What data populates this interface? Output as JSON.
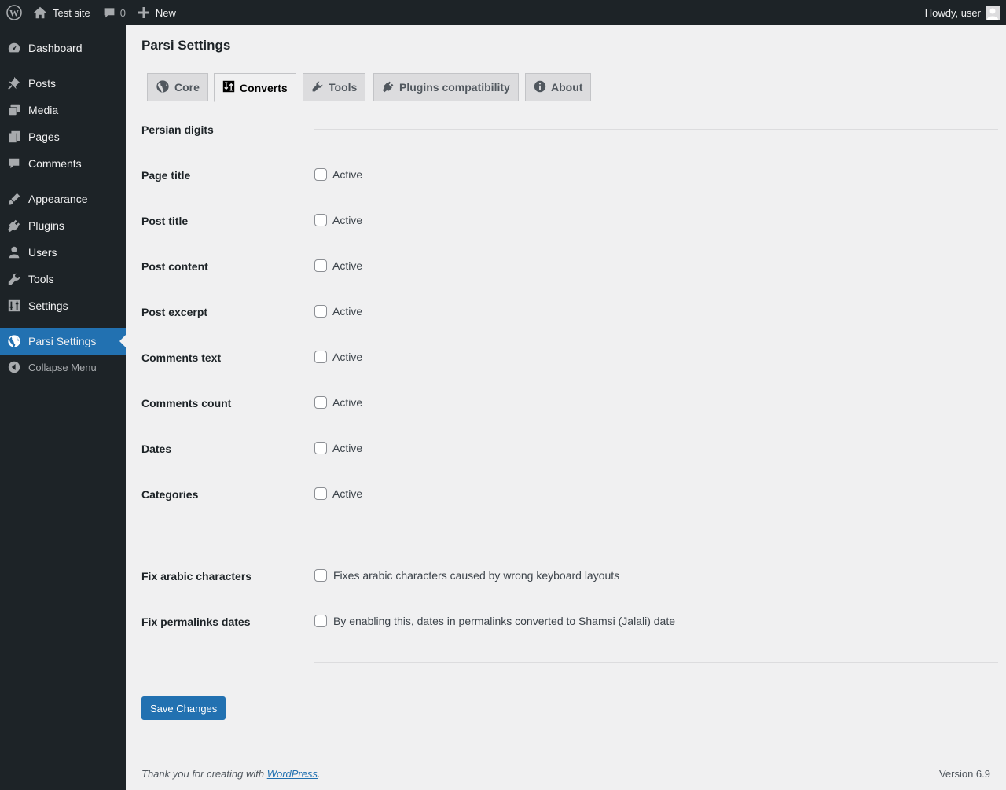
{
  "adminbar": {
    "site_name": "Test site",
    "comments_count": "0",
    "new_label": "New",
    "howdy": "Howdy, user"
  },
  "sidebar": {
    "items": [
      {
        "label": "Dashboard",
        "icon": "dashboard-icon"
      },
      {
        "label": "Posts",
        "icon": "pin-icon"
      },
      {
        "label": "Media",
        "icon": "media-icon"
      },
      {
        "label": "Pages",
        "icon": "pages-icon"
      },
      {
        "label": "Comments",
        "icon": "comment-icon"
      },
      {
        "label": "Appearance",
        "icon": "brush-icon"
      },
      {
        "label": "Plugins",
        "icon": "plug-icon"
      },
      {
        "label": "Users",
        "icon": "user-icon"
      },
      {
        "label": "Tools",
        "icon": "wrench-icon"
      },
      {
        "label": "Settings",
        "icon": "sliders-icon"
      },
      {
        "label": "Parsi Settings",
        "icon": "globe-icon",
        "current": true
      }
    ],
    "collapse_label": "Collapse Menu"
  },
  "page": {
    "title": "Parsi Settings",
    "tabs": [
      {
        "label": "Core",
        "icon": "globe-icon"
      },
      {
        "label": "Converts",
        "icon": "sort-icon",
        "active": true
      },
      {
        "label": "Tools",
        "icon": "wrench-icon"
      },
      {
        "label": "Plugins compatibility",
        "icon": "plug-icon"
      },
      {
        "label": "About",
        "icon": "info-icon"
      }
    ],
    "section_title": "Persian digits",
    "rows": [
      {
        "label": "Page title",
        "option": "Active",
        "checked": false
      },
      {
        "label": "Post title",
        "option": "Active",
        "checked": false
      },
      {
        "label": "Post content",
        "option": "Active",
        "checked": false
      },
      {
        "label": "Post excerpt",
        "option": "Active",
        "checked": false
      },
      {
        "label": "Comments text",
        "option": "Active",
        "checked": false
      },
      {
        "label": "Comments count",
        "option": "Active",
        "checked": false
      },
      {
        "label": "Dates",
        "option": "Active",
        "checked": false
      },
      {
        "label": "Categories",
        "option": "Active",
        "checked": false
      }
    ],
    "extra_rows": [
      {
        "label": "Fix arabic characters",
        "option": "Fixes arabic characters caused by wrong keyboard layouts",
        "checked": false
      },
      {
        "label": "Fix permalinks dates",
        "option": "By enabling this, dates in permalinks converted to Shamsi (Jalali) date",
        "checked": false
      }
    ],
    "save_label": "Save Changes"
  },
  "footer": {
    "thanks_prefix": "Thank you for creating with ",
    "thanks_link": "WordPress",
    "thanks_suffix": ".",
    "version": "Version 6.9"
  },
  "colors": {
    "adminbar_bg": "#1d2327",
    "accent": "#2271b1",
    "page_bg": "#f0f0f1"
  }
}
